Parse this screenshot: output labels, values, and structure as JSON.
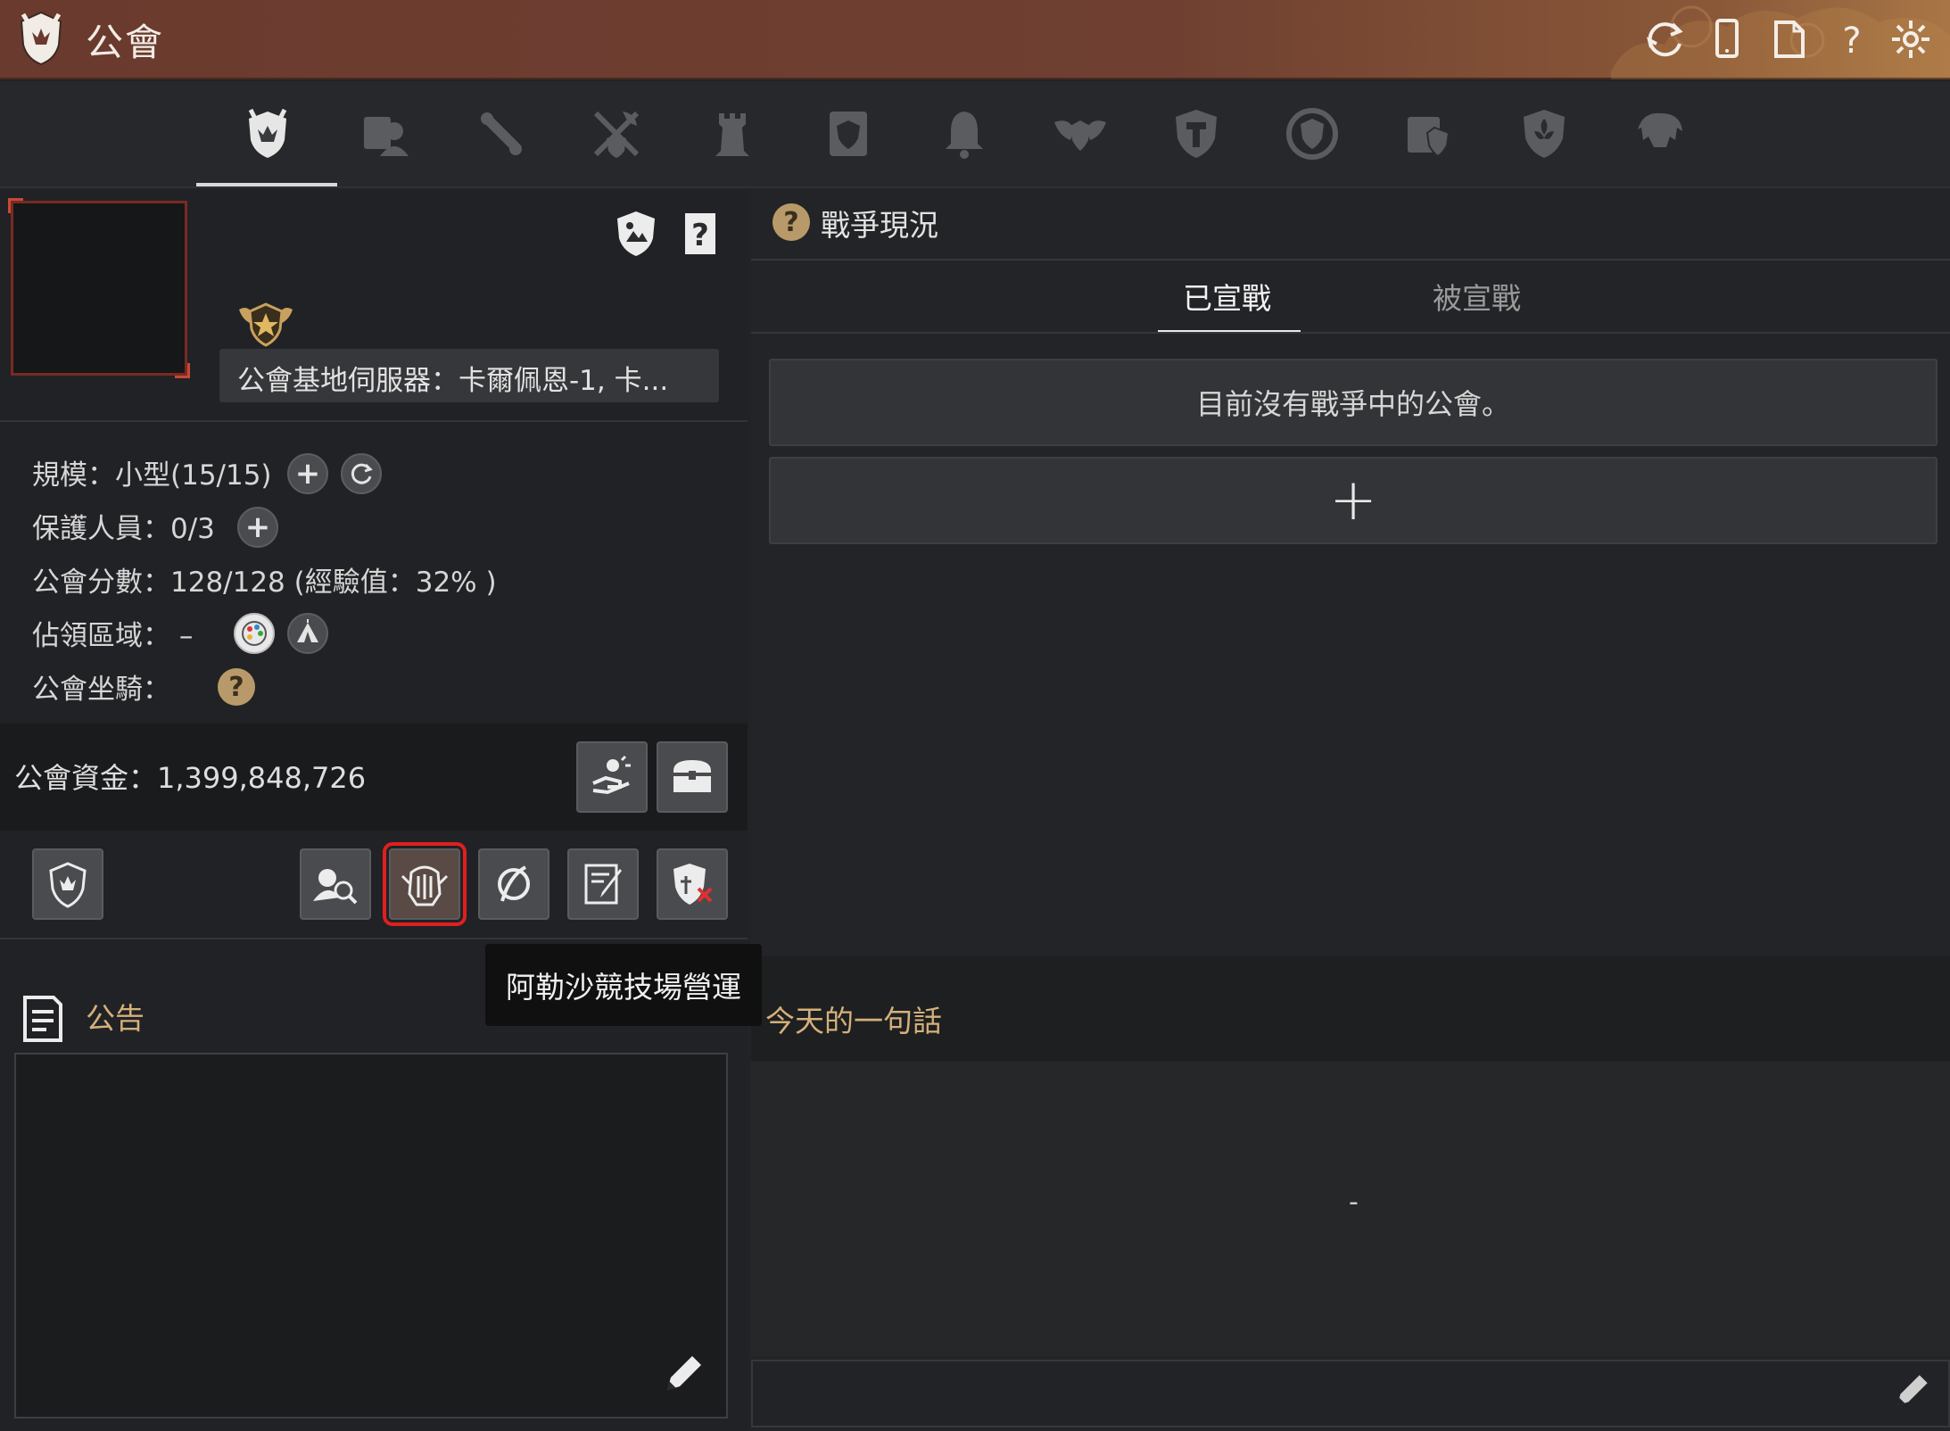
{
  "window": {
    "title": "公會"
  },
  "titlebar_buttons": [
    "refresh-icon",
    "mobile-icon",
    "page-icon",
    "help-icon",
    "settings-icon"
  ],
  "tabs": [
    {
      "name": "guild-info",
      "active": true
    },
    {
      "name": "guild-members"
    },
    {
      "name": "guild-quest"
    },
    {
      "name": "guild-war"
    },
    {
      "name": "guild-tower"
    },
    {
      "name": "guild-notice"
    },
    {
      "name": "guild-alert"
    },
    {
      "name": "guild-alliance"
    },
    {
      "name": "guild-crafting"
    },
    {
      "name": "guild-emblem"
    },
    {
      "name": "guild-records"
    },
    {
      "name": "guild-lily"
    },
    {
      "name": "guild-mercenary"
    }
  ],
  "guild": {
    "server_label": "公會基地伺服器：卡爾佩恩-1, 卡...",
    "scale": "規模：小型(15/15)",
    "protectors": "保護人員：0/3",
    "score": "公會分數：128/128 (經驗值：32% )",
    "territory": "佔領區域： –",
    "mount": "公會坐騎：",
    "funds": "公會資金：1,399,848,726"
  },
  "tooltip": {
    "text": "阿勒沙競技場營運"
  },
  "notice": {
    "title": "公告",
    "content": ""
  },
  "war": {
    "title": "戰爭現況",
    "tabs": {
      "declared": "已宣戰",
      "received": "被宣戰"
    },
    "empty_message": "目前沒有戰爭中的公會。",
    "add_symbol": "+"
  },
  "motto": {
    "title": "今天的一句話",
    "content": "-"
  },
  "colors": {
    "accent_gold": "#d4b07a",
    "titlebar": "#6f4031",
    "selection_red": "#e01f1f"
  }
}
